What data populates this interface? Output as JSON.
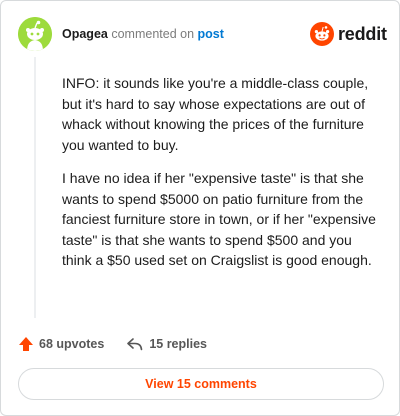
{
  "comment": {
    "username": "Opagea",
    "action_text": "commented on",
    "post_link": "post",
    "body_paragraphs": [
      "INFO: it sounds like you're a middle-class couple, but it's hard to say whose expectations are out of whack without knowing the prices of the furniture you wanted to buy.",
      "I have no idea if her \"expensive taste\" is that she wants to spend $5000 on patio furniture from the fanciest furniture store in town, or if her \"expensive taste\" is that she wants to spend $500 and you think a $50 used set on Craigslist is good enough."
    ]
  },
  "brand": {
    "name": "reddit",
    "accent": "#ff4500"
  },
  "footer": {
    "upvotes": "68 upvotes",
    "replies": "15 replies"
  },
  "view_comments": "View 15 comments",
  "colors": {
    "avatar_bg": "#9ddb3c",
    "link_blue": "#0079d3",
    "upvote_orange": "#ff4500"
  },
  "icons": [
    "snoo-avatar-icon",
    "reddit-logo-icon",
    "upvote-arrow-icon",
    "reply-arrow-icon"
  ]
}
